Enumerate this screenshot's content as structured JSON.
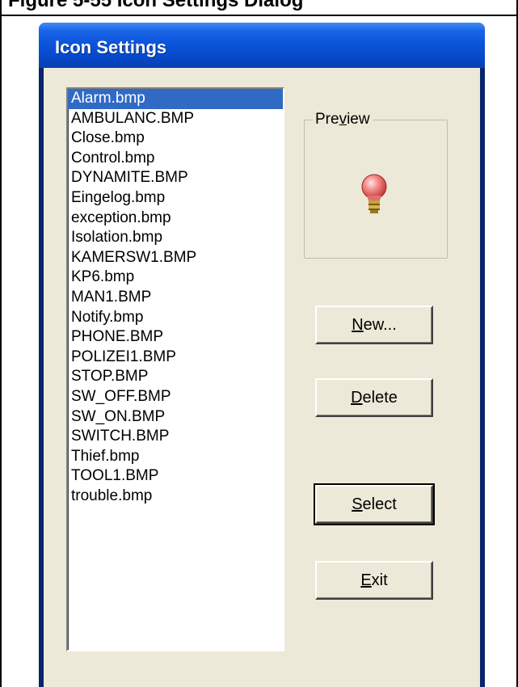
{
  "caption": {
    "text": "Figure 5-55 Icon Settings Dialog"
  },
  "window": {
    "title": "Icon Settings"
  },
  "file_list": {
    "selected_index": 0,
    "items": [
      "Alarm.bmp",
      "AMBULANC.BMP",
      "Close.bmp",
      "Control.bmp",
      "DYNAMITE.BMP",
      "Eingelog.bmp",
      "exception.bmp",
      "Isolation.bmp",
      "KAMERSW1.BMP",
      "KP6.bmp",
      "MAN1.BMP",
      "Notify.bmp",
      "PHONE.BMP",
      "POLIZEI1.BMP",
      "STOP.BMP",
      "SW_OFF.BMP",
      "SW_ON.BMP",
      "SWITCH.BMP",
      "Thief.bmp",
      "TOOL1.BMP",
      "trouble.bmp"
    ]
  },
  "preview": {
    "label_pre": "Pre",
    "label_mnemonic": "v",
    "label_post": "iew",
    "icon": "alarm-bulb-icon"
  },
  "buttons": {
    "new": {
      "mnemonic": "N",
      "rest": "ew..."
    },
    "delete": {
      "mnemonic": "D",
      "rest": "elete"
    },
    "select": {
      "mnemonic": "S",
      "rest": "elect"
    },
    "exit": {
      "mnemonic": "E",
      "rest": "xit"
    }
  },
  "colors": {
    "selection": "#316ac5",
    "dialog_face": "#ece9d8",
    "titlebar": "#0a53d9"
  }
}
